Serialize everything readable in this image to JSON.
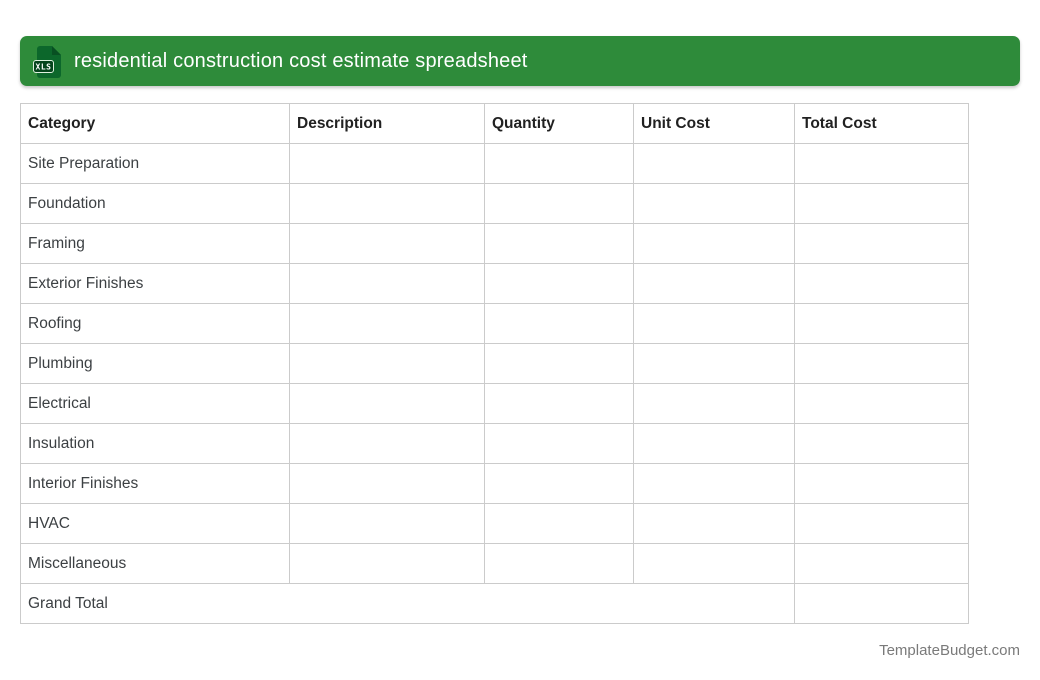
{
  "banner": {
    "title": "residential construction cost estimate spreadsheet",
    "icon_label": "XLS",
    "colors": {
      "banner_bg": "#2E8B3A",
      "icon_body": "#0C672B",
      "icon_fold": "#085022",
      "icon_badge_bg": "#05441C",
      "title_text": "#FFFFFF"
    }
  },
  "table": {
    "columns": [
      "Category",
      "Description",
      "Quantity",
      "Unit Cost",
      "Total Cost"
    ],
    "rows": [
      {
        "category": "Site Preparation",
        "description": "",
        "quantity": "",
        "unit_cost": "",
        "total_cost": ""
      },
      {
        "category": "Foundation",
        "description": "",
        "quantity": "",
        "unit_cost": "",
        "total_cost": ""
      },
      {
        "category": "Framing",
        "description": "",
        "quantity": "",
        "unit_cost": "",
        "total_cost": ""
      },
      {
        "category": "Exterior Finishes",
        "description": "",
        "quantity": "",
        "unit_cost": "",
        "total_cost": ""
      },
      {
        "category": "Roofing",
        "description": "",
        "quantity": "",
        "unit_cost": "",
        "total_cost": ""
      },
      {
        "category": "Plumbing",
        "description": "",
        "quantity": "",
        "unit_cost": "",
        "total_cost": ""
      },
      {
        "category": "Electrical",
        "description": "",
        "quantity": "",
        "unit_cost": "",
        "total_cost": ""
      },
      {
        "category": "Insulation",
        "description": "",
        "quantity": "",
        "unit_cost": "",
        "total_cost": ""
      },
      {
        "category": "Interior Finishes",
        "description": "",
        "quantity": "",
        "unit_cost": "",
        "total_cost": ""
      },
      {
        "category": "HVAC",
        "description": "",
        "quantity": "",
        "unit_cost": "",
        "total_cost": ""
      },
      {
        "category": "Miscellaneous",
        "description": "",
        "quantity": "",
        "unit_cost": "",
        "total_cost": ""
      }
    ],
    "grand_total_row": {
      "label": "Grand Total",
      "total_cost": ""
    }
  },
  "footer": {
    "credit": "TemplateBudget.com"
  }
}
